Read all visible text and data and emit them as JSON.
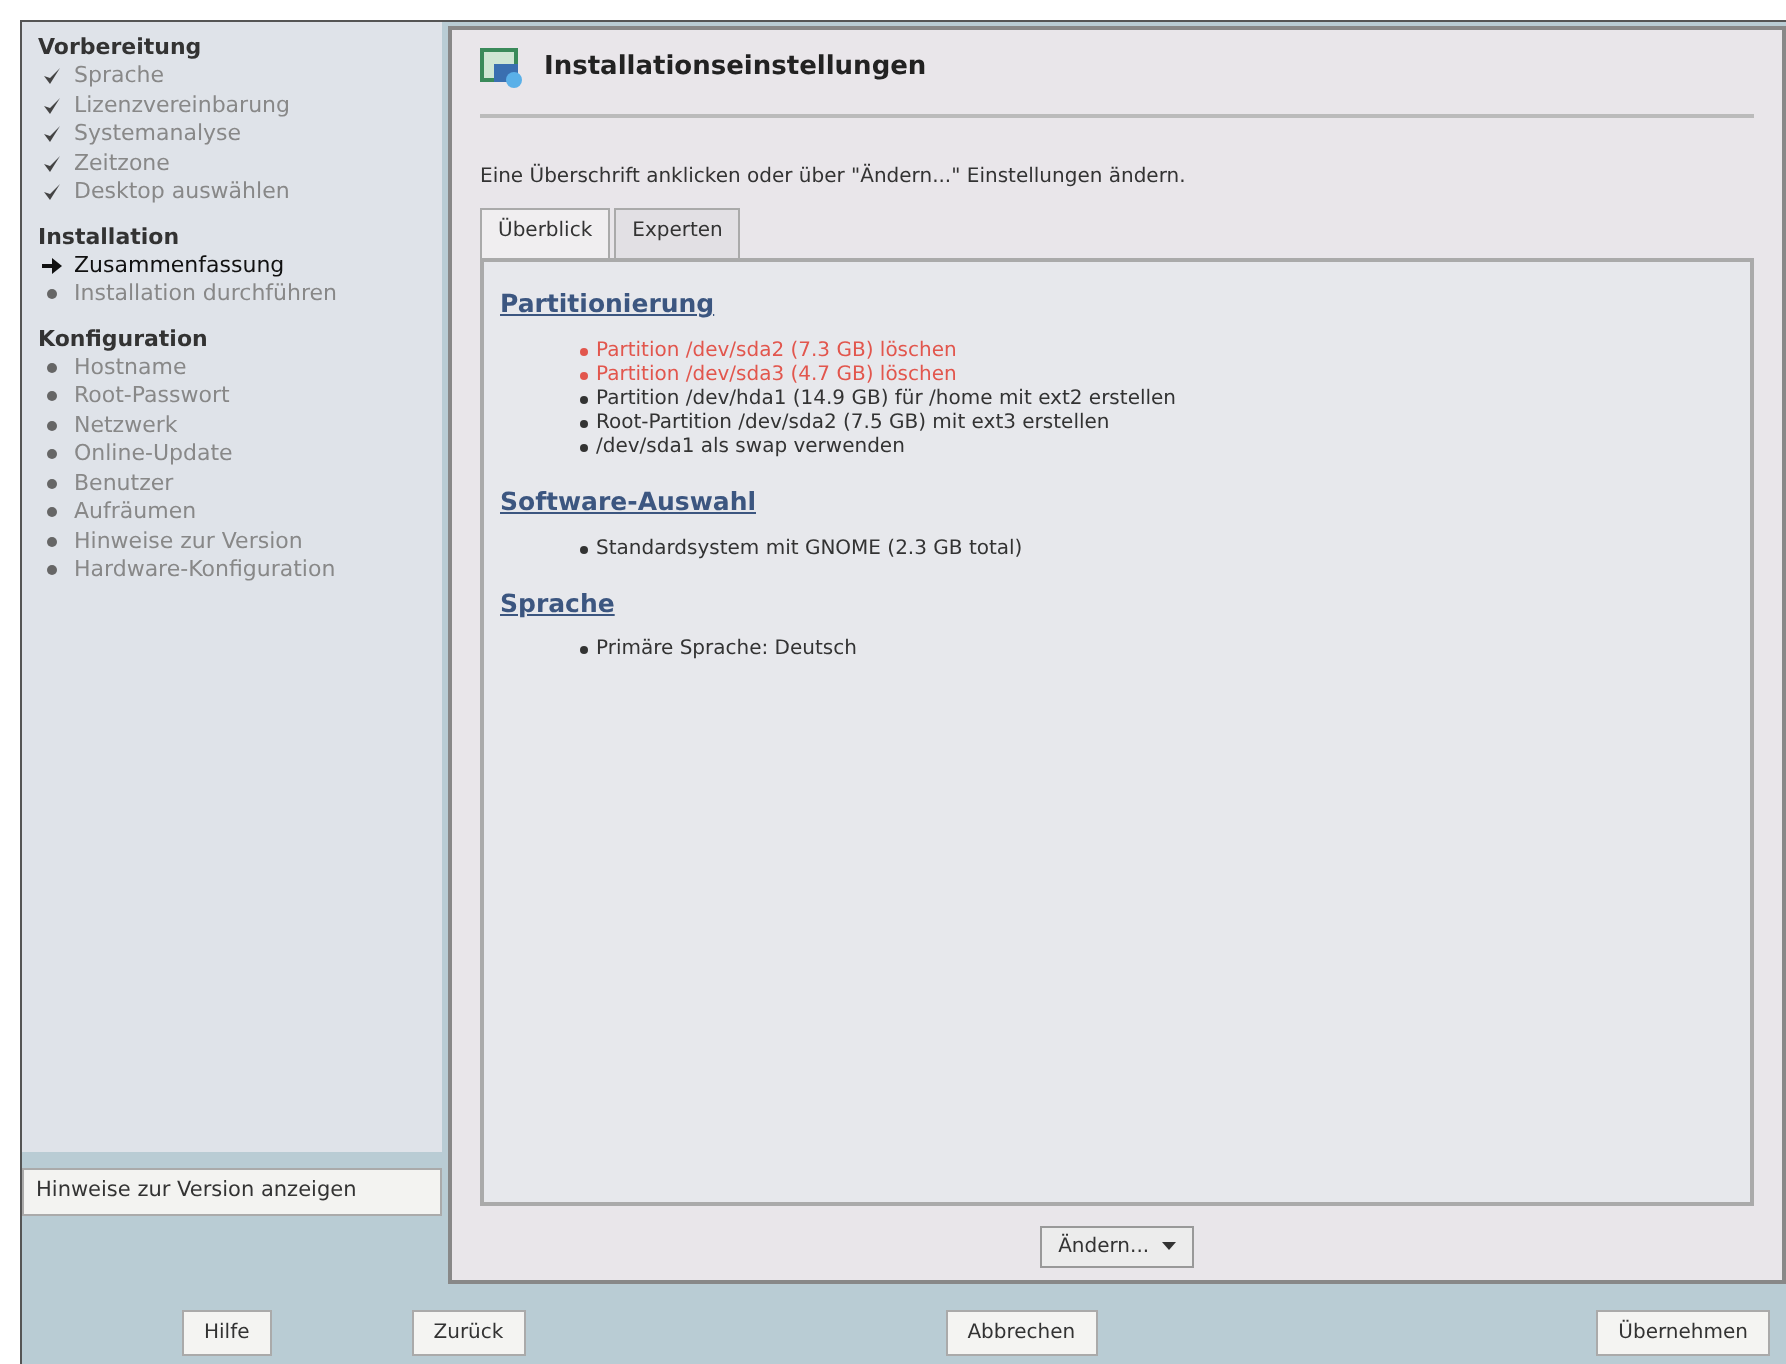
{
  "sidebar": {
    "groups": [
      {
        "title": "Vorbereitung",
        "items": [
          {
            "label": "Sprache",
            "kind": "done"
          },
          {
            "label": "Lizenzvereinbarung",
            "kind": "done"
          },
          {
            "label": "Systemanalyse",
            "kind": "done"
          },
          {
            "label": "Zeitzone",
            "kind": "done"
          },
          {
            "label": "Desktop auswählen",
            "kind": "done"
          }
        ]
      },
      {
        "title": "Installation",
        "items": [
          {
            "label": "Zusammenfassung",
            "kind": "current"
          },
          {
            "label": "Installation durchführen",
            "kind": "pending"
          }
        ]
      },
      {
        "title": "Konfiguration",
        "items": [
          {
            "label": "Hostname",
            "kind": "pending"
          },
          {
            "label": "Root-Passwort",
            "kind": "pending"
          },
          {
            "label": "Netzwerk",
            "kind": "pending"
          },
          {
            "label": "Online-Update",
            "kind": "pending"
          },
          {
            "label": "Benutzer",
            "kind": "pending"
          },
          {
            "label": "Aufräumen",
            "kind": "pending"
          },
          {
            "label": "Hinweise zur Version",
            "kind": "pending"
          },
          {
            "label": "Hardware-Konfiguration",
            "kind": "pending"
          }
        ]
      }
    ],
    "button": "Hinweise zur Version anzeigen"
  },
  "panel": {
    "title": "Installationseinstellungen",
    "hint": "Eine Überschrift anklicken oder über \"Ändern...\" Einstellungen ändern.",
    "tabs": [
      {
        "label": "Überblick",
        "selected": true
      },
      {
        "label": "Experten",
        "selected": false
      }
    ],
    "sections": [
      {
        "heading": "Partitionierung",
        "items": [
          {
            "text": "Partition /dev/sda2 (7.3 GB) löschen",
            "warning": true
          },
          {
            "text": "Partition /dev/sda3 (4.7 GB) löschen",
            "warning": true
          },
          {
            "text": "Partition /dev/hda1 (14.9 GB) für /home mit ext2 erstellen",
            "warning": false
          },
          {
            "text": "Root-Partition /dev/sda2 (7.5 GB) mit ext3 erstellen",
            "warning": false
          },
          {
            "text": "/dev/sda1 als swap verwenden",
            "warning": false
          }
        ]
      },
      {
        "heading": "Software-Auswahl",
        "items": [
          {
            "text": "Standardsystem mit GNOME (2.3 GB total)",
            "warning": false
          }
        ]
      },
      {
        "heading": "Sprache",
        "items": [
          {
            "text": "Primäre Sprache: Deutsch",
            "warning": false
          }
        ]
      }
    ],
    "change_button": "Ändern..."
  },
  "footer_buttons": [
    "Hilfe",
    "Zurück",
    "Abbrechen",
    "Übernehmen"
  ]
}
